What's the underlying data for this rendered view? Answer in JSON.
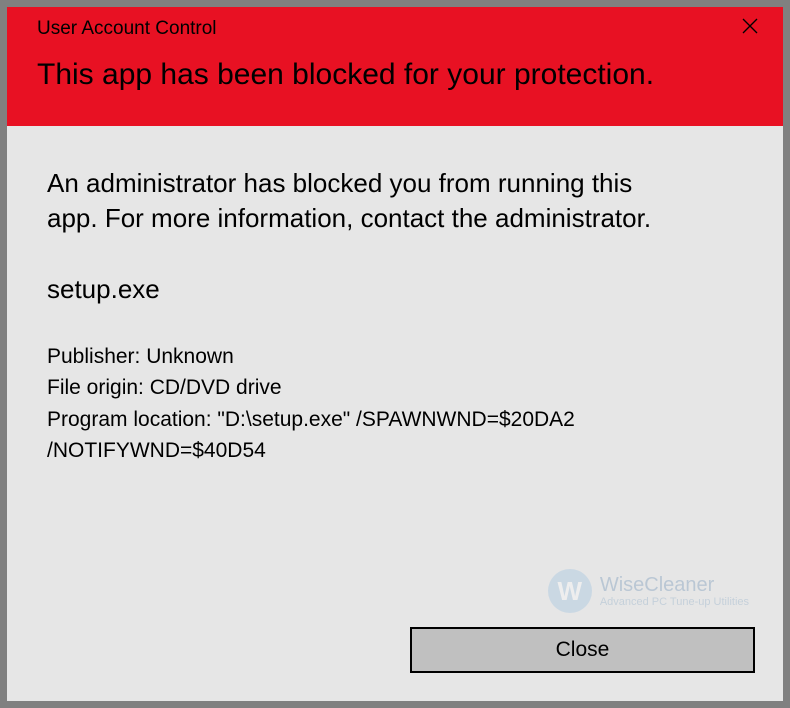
{
  "header": {
    "title_small": "User Account Control",
    "title_large": "This app has been blocked for your protection."
  },
  "body": {
    "message": "An administrator has blocked you from running this app. For more information, contact the administrator.",
    "filename": "setup.exe",
    "publisher_line": "Publisher: Unknown",
    "origin_line": "File origin: CD/DVD drive",
    "location_line": "Program location: \"D:\\setup.exe\" /SPAWNWND=$20DA2 /NOTIFYWND=$40D54"
  },
  "footer": {
    "close_label": "Close"
  },
  "watermark": {
    "logo_letter": "W",
    "brand": "WiseCleaner",
    "tagline": "Advanced PC Tune-up Utilities"
  }
}
